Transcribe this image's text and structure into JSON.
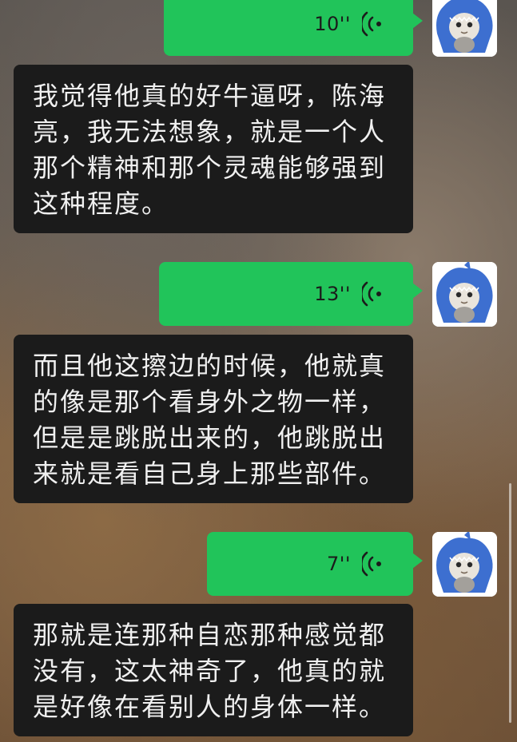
{
  "messages": [
    {
      "type": "voice",
      "sender": "me",
      "duration": "10''"
    },
    {
      "type": "text",
      "sender": "transcript",
      "text": "我觉得他真的好牛逼呀，陈海亮，我无法想象，就是一个人那个精神和那个灵魂能够强到这种程度。"
    },
    {
      "type": "voice",
      "sender": "me",
      "duration": "13''"
    },
    {
      "type": "text",
      "sender": "transcript",
      "text": "而且他这擦边的时候，他就真的像是那个看身外之物一样，但是是跳脱出来的，他跳脱出来就是看自己身上那些部件。"
    },
    {
      "type": "voice",
      "sender": "me",
      "duration": "7''"
    },
    {
      "type": "text",
      "sender": "transcript",
      "text": "那就是连那种自恋那种感觉都没有，这太神奇了，他真的就是好像在看别人的身体一样。"
    }
  ],
  "colors": {
    "voice_bubble": "#21c45a",
    "text_bubble": "#1b1b1b",
    "text": "#f0f0f0",
    "avatar_shark": "#3d6fd0"
  },
  "icons": {
    "voice_wave": "voice-wave-icon",
    "avatar": "shark-costume-cat-avatar"
  }
}
